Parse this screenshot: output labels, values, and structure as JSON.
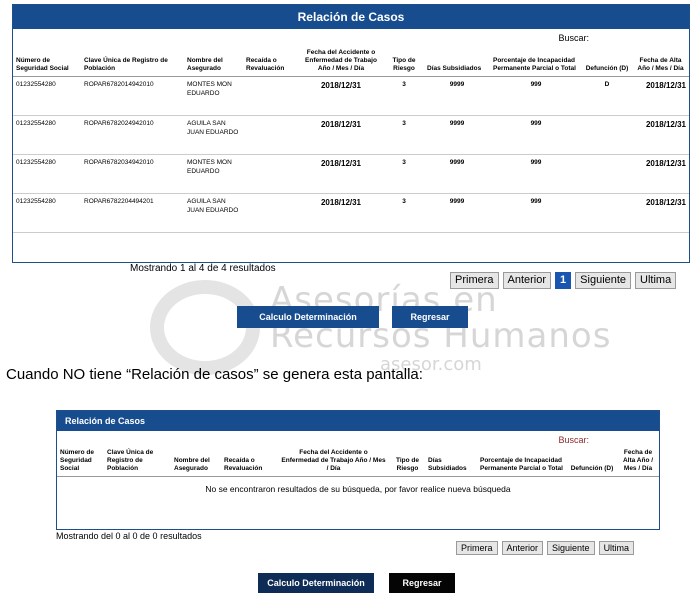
{
  "watermark": {
    "line1": "Asesorías en",
    "line2": "Recursos Humanos",
    "line3": "asesor.com"
  },
  "screen1": {
    "title": "Relación de Casos",
    "search_label": "Buscar:",
    "columns": [
      "Número de Seguridad Social",
      "Clave Única de Registro de Población",
      "Nombre del Asegurado",
      "Recaída o Revaluación",
      "Fecha del Accidente o Enfermedad de Trabajo Año / Mes / Día",
      "Tipo de Riesgo",
      "Días Subsidiados",
      "Porcentaje de Incapacidad Permanente Parcial o Total",
      "Defunción (D)",
      "Fecha de Alta Año / Mes / Día"
    ],
    "rows": [
      {
        "nss": "01232554280",
        "curp": "ROPAR6782014942010",
        "nombre": "MONTES MON EDUARDO",
        "recaida": "",
        "fecha": "2018/12/31",
        "tipo": "3",
        "dias": "9999",
        "porcentaje": "999",
        "defuncion": "D",
        "alta": "2018/12/31"
      },
      {
        "nss": "01232554280",
        "curp": "ROPAR6782024942010",
        "nombre": "AGUILA SAN JUAN EDUARDO",
        "recaida": "",
        "fecha": "2018/12/31",
        "tipo": "3",
        "dias": "9999",
        "porcentaje": "999",
        "defuncion": "",
        "alta": "2018/12/31"
      },
      {
        "nss": "01232554280",
        "curp": "ROPAR6782034942010",
        "nombre": "MONTES MON EDUARDO",
        "recaida": "",
        "fecha": "2018/12/31",
        "tipo": "3",
        "dias": "9999",
        "porcentaje": "999",
        "defuncion": "",
        "alta": "2018/12/31"
      },
      {
        "nss": "01232554280",
        "curp": "ROPAR6782204494201",
        "nombre": "AGUILA SAN JUAN EDUARDO",
        "recaida": "",
        "fecha": "2018/12/31",
        "tipo": "3",
        "dias": "9999",
        "porcentaje": "999",
        "defuncion": "",
        "alta": "2018/12/31"
      }
    ],
    "info": "Mostrando 1 al 4 de 4 resultados",
    "pager": {
      "first": "Primera",
      "prev": "Anterior",
      "current": "1",
      "next": "Siguiente",
      "last": "Ultima"
    },
    "calc_label": "Calculo Determinación",
    "back_label": "Regresar"
  },
  "caption": "Cuando NO tiene “Relación de casos” se genera esta pantalla:",
  "screen2": {
    "title": "Relación de Casos",
    "search_label": "Buscar:",
    "columns": [
      "Número de Seguridad Social",
      "Clave Única de Registro de Población",
      "Nombre del Asegurado",
      "Recaída o Revaluación",
      "Fecha del Accidente o Enfermedad de Trabajo Año / Mes / Día",
      "Tipo de Riesgo",
      "Días Subsidiados",
      "Porcentaje de Incapacidad Permanente Parcial o Total",
      "Defunción (D)",
      "Fecha de Alta Año / Mes / Día"
    ],
    "no_results": "No se encontraron resultados de su búsqueda, por favor realice nueva búsqueda",
    "info": "Mostrando del 0 al 0 de 0 resultados",
    "pager": {
      "first": "Primera",
      "prev": "Anterior",
      "next": "Siguiente",
      "last": "Ultima"
    },
    "calc_label": "Calculo Determinación",
    "back_label": "Regresar"
  }
}
